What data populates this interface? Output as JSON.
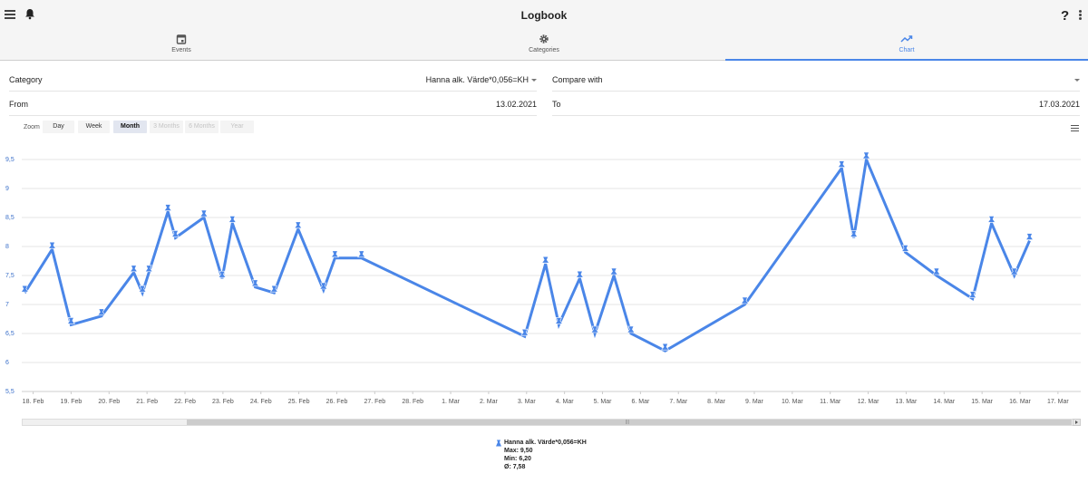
{
  "app": {
    "title": "Logbook",
    "help_label": "?"
  },
  "tabs": [
    {
      "label": "Events",
      "icon": "calendar-icon"
    },
    {
      "label": "Categories",
      "icon": "gear-icon"
    },
    {
      "label": "Chart",
      "icon": "trending-up-icon",
      "active": true
    }
  ],
  "form": {
    "category_label": "Category",
    "category_value": "Hanna alk. Värde*0,056=KH",
    "compare_label": "Compare with",
    "compare_value": "",
    "from_label": "From",
    "from_value": "13.02.2021",
    "to_label": "To",
    "to_value": "17.03.2021"
  },
  "zoom": {
    "label": "Zoom",
    "buttons": [
      {
        "label": "Day",
        "state": "normal"
      },
      {
        "label": "Week",
        "state": "normal"
      },
      {
        "label": "Month",
        "state": "selected"
      },
      {
        "label": "3 Months",
        "state": "disabled"
      },
      {
        "label": "6 Months",
        "state": "disabled"
      },
      {
        "label": "Year",
        "state": "disabled"
      }
    ]
  },
  "scrollbar": {
    "grip": "|||"
  },
  "legend": {
    "name": "Hanna alk. Värde*0,056=KH",
    "max": "Max: 9,50",
    "min": "Min: 6,20",
    "avg": "Ø: 7,58"
  },
  "colors": {
    "accent": "#4a86e8",
    "line": "#4a86e8",
    "grid": "#e6e6e6"
  },
  "chart_data": {
    "type": "line",
    "title": "",
    "xlabel": "",
    "ylabel": "",
    "ylim": [
      5.5,
      9.75
    ],
    "yticks": [
      "5,5",
      "6",
      "6,5",
      "7",
      "7,5",
      "8",
      "8,5",
      "9",
      "9,5"
    ],
    "ytick_values": [
      5.5,
      6,
      6.5,
      7,
      7.5,
      8,
      8.5,
      9,
      9.5
    ],
    "xlim": [
      -0.3,
      27.6
    ],
    "xticks": [
      "18. Feb",
      "19. Feb",
      "20. Feb",
      "21. Feb",
      "22. Feb",
      "23. Feb",
      "24. Feb",
      "25. Feb",
      "26. Feb",
      "27. Feb",
      "28. Feb",
      "1. Mar",
      "2. Mar",
      "3. Mar",
      "4. Mar",
      "5. Mar",
      "6. Mar",
      "7. Mar",
      "8. Mar",
      "9. Mar",
      "10. Mar",
      "11. Mar",
      "12. Mar",
      "13. Mar",
      "14. Mar",
      "15. Mar",
      "16. Mar",
      "17. Mar"
    ],
    "grid": true,
    "legend_position": "bottom-center",
    "series": [
      {
        "name": "Hanna alk. Värde*0,056=KH",
        "marker": "flask-icon",
        "x": [
          -0.22,
          0.5,
          1.0,
          1.8,
          2.65,
          2.88,
          3.05,
          3.55,
          3.75,
          4.5,
          4.98,
          5.25,
          5.85,
          6.35,
          6.98,
          7.65,
          7.95,
          8.65,
          12.95,
          13.5,
          13.85,
          14.4,
          14.8,
          15.3,
          15.75,
          16.65,
          18.75,
          21.3,
          21.62,
          21.95,
          22.98,
          23.8,
          24.75,
          25.25,
          25.85,
          26.25
        ],
        "y": [
          7.2,
          7.95,
          6.65,
          6.8,
          7.55,
          7.2,
          7.55,
          8.6,
          8.15,
          8.5,
          7.45,
          8.4,
          7.3,
          7.2,
          8.3,
          7.25,
          7.8,
          7.8,
          6.45,
          7.7,
          6.65,
          7.45,
          6.5,
          7.5,
          6.5,
          6.2,
          7.0,
          9.35,
          8.15,
          9.5,
          7.9,
          7.5,
          7.1,
          8.4,
          7.5,
          8.1
        ]
      }
    ]
  }
}
